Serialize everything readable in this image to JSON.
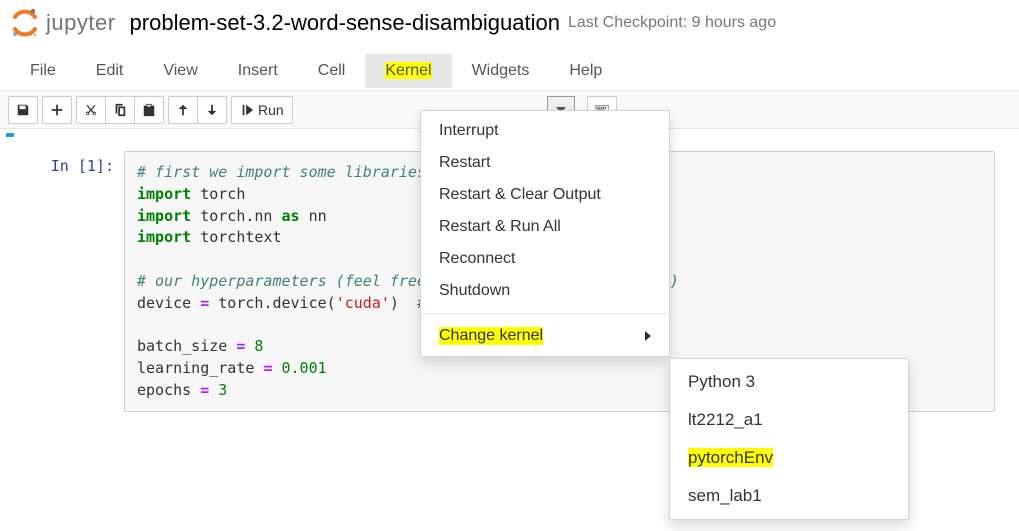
{
  "header": {
    "brand_text": "jupyter",
    "title": "problem-set-3.2-word-sense-disambiguation",
    "checkpoint": "Last Checkpoint: 9 hours ago"
  },
  "menubar": {
    "items": [
      {
        "label": "File"
      },
      {
        "label": "Edit"
      },
      {
        "label": "View"
      },
      {
        "label": "Insert"
      },
      {
        "label": "Cell"
      },
      {
        "label": "Kernel",
        "open": true,
        "highlight": true
      },
      {
        "label": "Widgets"
      },
      {
        "label": "Help"
      }
    ]
  },
  "toolbar": {
    "run_label": "Run"
  },
  "kernel_menu": {
    "items": [
      {
        "label": "Interrupt"
      },
      {
        "label": "Restart"
      },
      {
        "label": "Restart & Clear Output"
      },
      {
        "label": "Restart & Run All"
      },
      {
        "label": "Reconnect"
      },
      {
        "label": "Shutdown"
      }
    ],
    "change_kernel_label": "Change kernel",
    "kernels": [
      {
        "label": "Python 3"
      },
      {
        "label": "lt2212_a1"
      },
      {
        "label": "pytorchEnv",
        "highlight": true
      },
      {
        "label": "sem_lab1"
      }
    ]
  },
  "cell": {
    "prompt": "In [1]:",
    "code": {
      "l1": "# first we import some libraries we will need",
      "l2a": "import",
      "l2b": " torch",
      "l3a": "import",
      "l3b": " torch.nn ",
      "l3c": "as",
      "l3d": " nn",
      "l4a": "import",
      "l4b": " torchtext",
      "l6": "# our hyperparameters (feel free to change if you need them)",
      "l7a": "device ",
      "l7b": "=",
      "l7c": " torch.device(",
      "l7d": "'cuda'",
      "l7e": ")  ",
      "l7f": "# use the GPU if you can!",
      "l9a": "batch_size ",
      "l9b": "=",
      "l9c": " ",
      "l9d": "8",
      "l10a": "learning_rate ",
      "l10b": "=",
      "l10c": " ",
      "l10d": "0.001",
      "l11a": "epochs ",
      "l11b": "=",
      "l11c": " ",
      "l11d": "3"
    }
  }
}
